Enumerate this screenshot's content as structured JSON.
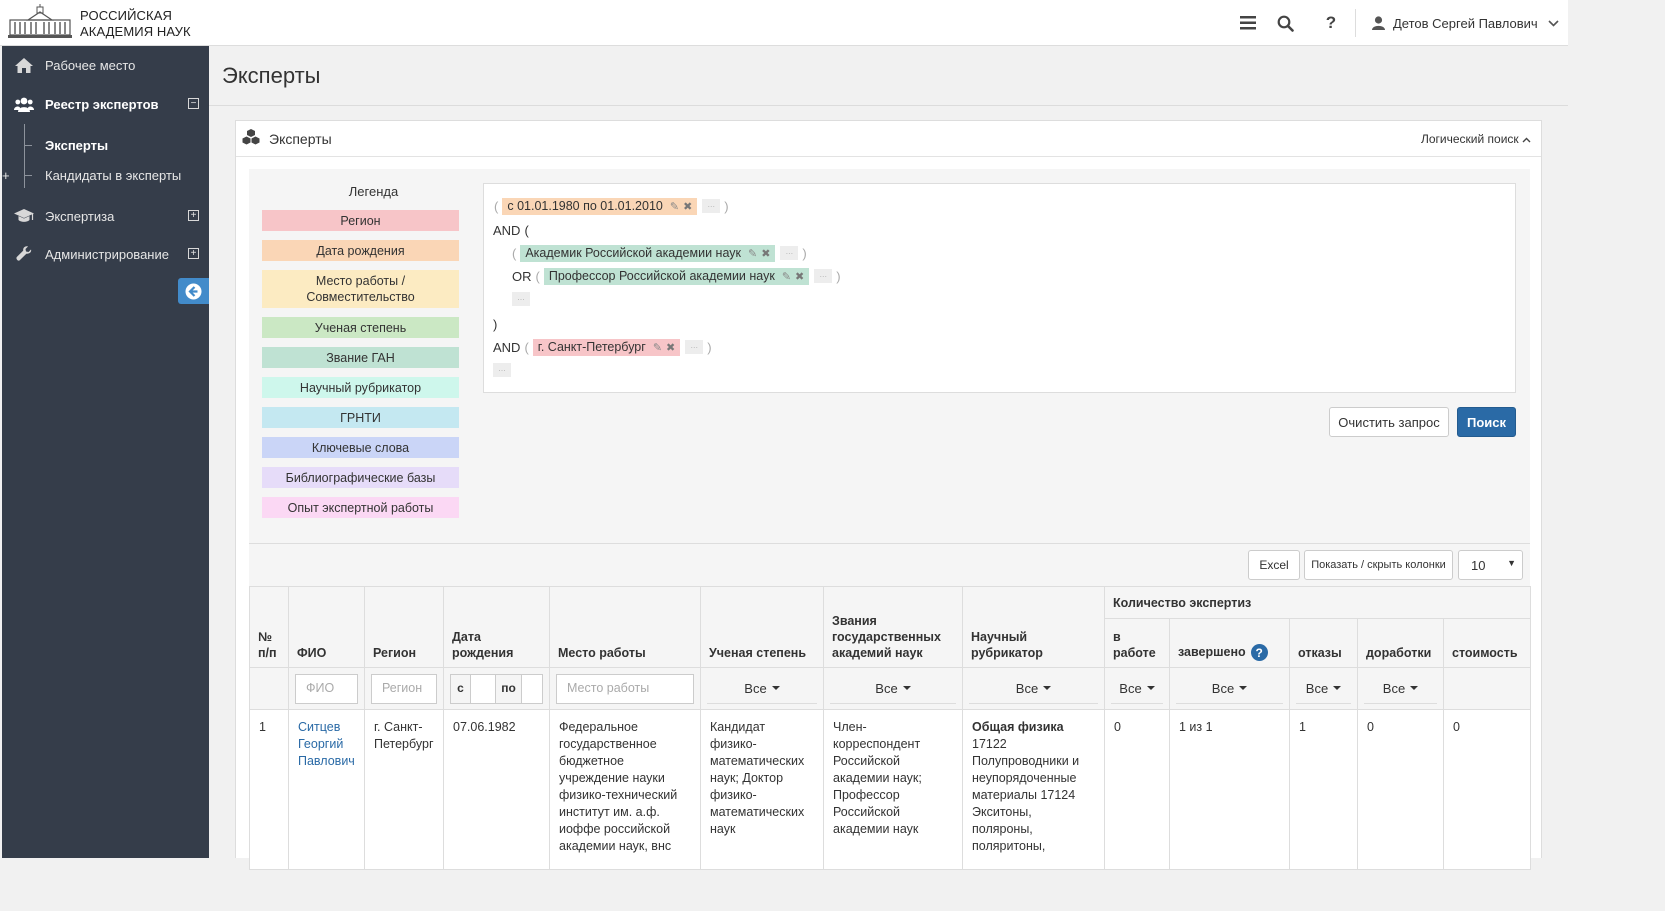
{
  "app": {
    "logo_line1": "РОССИЙСКАЯ",
    "logo_line2": "АКАДЕМИЯ НАУК",
    "user_name": "Детов Сергей Павлович"
  },
  "sidebar": {
    "items": [
      {
        "label": "Рабочее место",
        "icon": "home-icon"
      },
      {
        "label": "Реестр экспертов",
        "icon": "users-icon",
        "toggle": "−"
      },
      {
        "label": "Экспертиза",
        "icon": "graduation-cap-icon",
        "toggle": "+"
      },
      {
        "label": "Администрирование",
        "icon": "wrench-icon",
        "toggle": "+"
      }
    ],
    "subitems": [
      {
        "label": "Эксперты"
      },
      {
        "label": "Кандидаты в эксперты",
        "toggle": "+"
      }
    ]
  },
  "page": {
    "title": "Эксперты"
  },
  "panel": {
    "title": "Эксперты",
    "logic_search_link": "Логический поиск"
  },
  "legend": {
    "title": "Легенда",
    "items": [
      {
        "label": "Регион",
        "color": "#f7c5c8"
      },
      {
        "label": "Дата рождения",
        "color": "#fad6b6"
      },
      {
        "label": "Место работы / Совместительство",
        "color": "#fcebc2"
      },
      {
        "label": "Ученая степень",
        "color": "#cbe8c4"
      },
      {
        "label": "Звание ГАН",
        "color": "#bfe2d3"
      },
      {
        "label": "Научный рубрикатор",
        "color": "#cef7ec"
      },
      {
        "label": "ГРНТИ",
        "color": "#c4e8f1"
      },
      {
        "label": "Ключевые слова",
        "color": "#cad5f7"
      },
      {
        "label": "Библиографические базы",
        "color": "#e6dcf9"
      },
      {
        "label": "Опыт экспертной работы",
        "color": "#fbd8f4"
      }
    ]
  },
  "query": {
    "open_paren": "(",
    "close_paren": ")",
    "dots": "...",
    "op_and": "AND",
    "op_or": "OR",
    "chip_birth": "с 01.01.1980 по 01.01.2010",
    "chip_academician": "Академик Российской академии наук",
    "chip_professor": "Профессор Российской академии наук",
    "chip_region": "г. Санкт-Петербург"
  },
  "buttons": {
    "clear": "Очистить запрос",
    "search": "Поиск",
    "excel": "Excel",
    "toggle_columns": "Показать / скрыть колонки",
    "page_size": "10"
  },
  "table": {
    "headers": {
      "num": "№ п/п",
      "fio": "ФИО",
      "region": "Регион",
      "birth": "Дата рождения",
      "work": "Место работы",
      "degree": "Ученая степень",
      "titles": "Звания государственных академий наук",
      "rubric": "Научный рубрикатор",
      "count_group": "Количество экспертиз",
      "in_work": "в работе",
      "done": "завершено",
      "refusals": "отказы",
      "revisions": "доработки",
      "cost": "стоимость"
    },
    "filters": {
      "fio": "ФИО",
      "region": "Регион",
      "from": "с",
      "to": "по",
      "work": "Место работы",
      "all": "Все"
    },
    "rows": [
      {
        "num": "1",
        "fio": "Ситцев Георгий Павлович",
        "region": "г. Санкт-Петербург",
        "birth": "07.06.1982",
        "work": "Федеральное государственное бюджетное учреждение науки физико-технический институт им. а.ф. иоффе российской академии наук, внс",
        "degree": "Кандидат физико-математических наук; Доктор физико-математических наук",
        "titles": "Член-корреспондент Российской академии наук; Профессор Российской академии наук",
        "rubric_title": "Общая физика",
        "rubric_text": "17122 Полупроводники и неупорядоченные материалы 17124 Экситоны, поляроны, поляритоны,",
        "in_work": "0",
        "done": "1 из 1",
        "refusals": "1",
        "revisions": "0",
        "cost": "0"
      }
    ]
  }
}
